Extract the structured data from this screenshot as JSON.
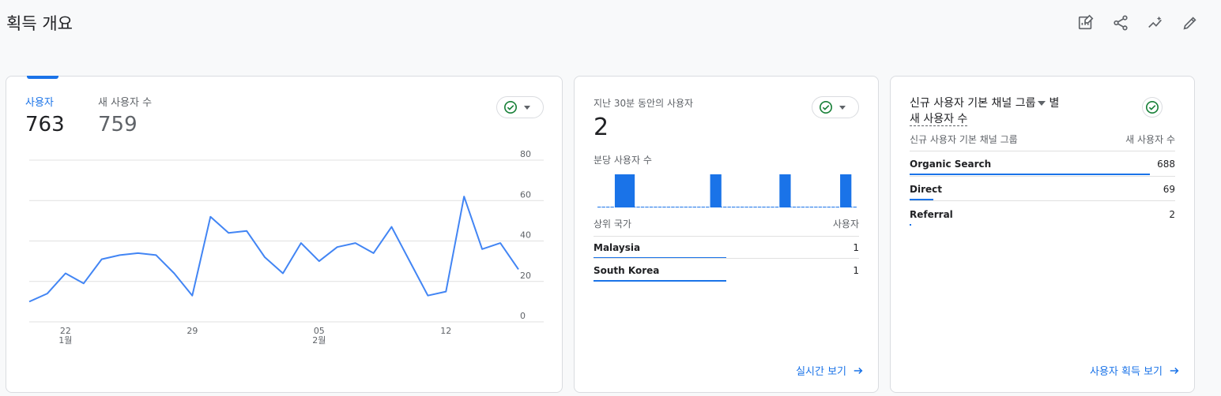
{
  "page": {
    "title": "획득 개요"
  },
  "toolbar": {
    "icons": [
      "customize-report-icon",
      "share-icon",
      "insights-icon",
      "edit-icon"
    ]
  },
  "overview": {
    "metrics": [
      {
        "label": "사용자",
        "value": "763",
        "active": true
      },
      {
        "label": "새 사용자 수",
        "value": "759",
        "active": false
      }
    ],
    "chart_data": {
      "type": "line",
      "x": [
        "1월 20",
        "1월 21",
        "1월 22",
        "1월 23",
        "1월 24",
        "1월 25",
        "1월 26",
        "1월 27",
        "1월 28",
        "1월 29",
        "1월 30",
        "1월 31",
        "2월 01",
        "2월 02",
        "2월 03",
        "2월 04",
        "2월 05",
        "2월 06",
        "2월 07",
        "2월 08",
        "2월 09",
        "2월 10",
        "2월 11",
        "2월 12",
        "2월 13",
        "2월 14",
        "2월 15",
        "2월 16"
      ],
      "series": [
        {
          "values": [
            10,
            14,
            24,
            19,
            31,
            33,
            34,
            33,
            24,
            13,
            52,
            44,
            45,
            32,
            24,
            39,
            30,
            37,
            39,
            34,
            47,
            30,
            13,
            15,
            62,
            36,
            39,
            26
          ]
        }
      ],
      "x_tick_labels": [
        {
          "day": "22",
          "month": "1월"
        },
        {
          "day": "29",
          "month": ""
        },
        {
          "day": "05",
          "month": "2월"
        },
        {
          "day": "12",
          "month": ""
        }
      ],
      "y_ticks": [
        "0",
        "20",
        "40",
        "60",
        "80"
      ],
      "ylim": [
        0,
        80
      ],
      "color": "#4285f4",
      "grid": true
    }
  },
  "realtime": {
    "label": "지난 30분 동안의 사용자",
    "value": "2",
    "per_minute_label": "분당 사용자 수",
    "per_minute_bars": [
      0,
      0,
      0,
      0,
      1,
      0,
      1,
      0,
      0,
      0,
      0,
      0,
      0,
      0,
      0,
      0,
      0,
      0,
      0,
      0,
      0,
      0,
      0,
      0,
      0,
      0,
      1,
      0,
      0,
      0,
      0,
      0,
      0,
      0,
      0,
      0,
      0,
      0,
      0,
      0,
      0,
      0,
      1,
      0,
      0,
      0,
      0,
      0,
      0,
      0,
      0,
      0,
      0,
      0,
      0,
      0,
      1,
      0,
      0,
      0
    ],
    "table": {
      "col_country": "상위 국가",
      "col_users": "사용자",
      "rows": [
        {
          "name": "Malaysia",
          "value": "1",
          "fraction": 1.0
        },
        {
          "name": "South Korea",
          "value": "1",
          "fraction": 1.0
        }
      ]
    },
    "link": "실시간 보기"
  },
  "channels": {
    "title_part1": "신규 사용자 기본 채널 그룹",
    "title_part2": "별",
    "title_metric": "새 사용자 수",
    "col_channel": "신규 사용자 기본 채널 그룹",
    "col_value": "새 사용자 수",
    "rows": [
      {
        "name": "Organic Search",
        "value": "688",
        "fraction": 1.0
      },
      {
        "name": "Direct",
        "value": "69",
        "fraction": 0.1
      },
      {
        "name": "Referral",
        "value": "2",
        "fraction": 0.003
      }
    ],
    "link": "사용자 획득 보기"
  },
  "colors": {
    "accent": "#1a73e8",
    "line": "#4285f4",
    "check": "#188038"
  }
}
